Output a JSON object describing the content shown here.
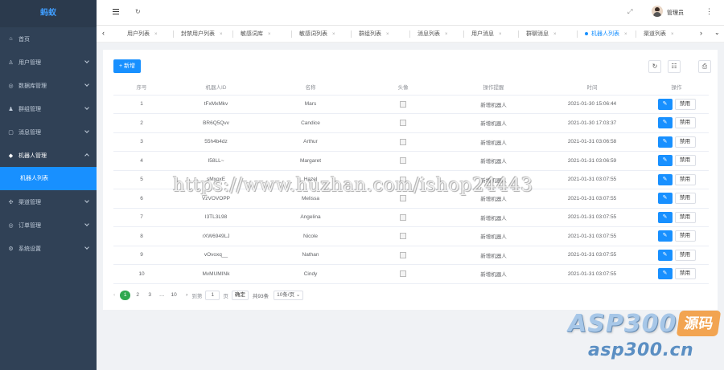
{
  "sidebar": {
    "logo": "蚂蚁",
    "items": [
      {
        "label": "首页",
        "icon": "home-icon",
        "glyph": "⌂"
      },
      {
        "label": "用户管理",
        "icon": "user-icon",
        "glyph": "♙"
      },
      {
        "label": "数据库管理",
        "icon": "database-icon",
        "glyph": "◎"
      },
      {
        "label": "群组管理",
        "icon": "group-icon",
        "glyph": "♟"
      },
      {
        "label": "消息管理",
        "icon": "message-icon",
        "glyph": "▢"
      },
      {
        "label": "机器人管理",
        "icon": "robot-icon",
        "glyph": "◆"
      },
      {
        "label": "渠道管理",
        "icon": "channel-icon",
        "glyph": "✣"
      },
      {
        "label": "订单管理",
        "icon": "order-icon",
        "glyph": "◎"
      },
      {
        "label": "系统设置",
        "icon": "settings-icon",
        "glyph": "⚙"
      }
    ],
    "submenu_selected": "机器人列表"
  },
  "header": {
    "username": "管理员",
    "hamburger_icon": "menu-toggle-icon",
    "refresh_glyph": "↻",
    "fullscreen_glyph": "⤢",
    "more_glyph": "⋮"
  },
  "tabs": {
    "items": [
      {
        "label": "用户列表"
      },
      {
        "label": "封禁用户列表"
      },
      {
        "label": "敏感词库"
      },
      {
        "label": "敏感词列表"
      },
      {
        "label": "群组列表"
      },
      {
        "label": "消息列表"
      },
      {
        "label": "用户消息"
      },
      {
        "label": "群聊消息"
      },
      {
        "label": "机器人列表",
        "active": true
      },
      {
        "label": "渠道列表"
      }
    ],
    "close_glyph": "×",
    "left_arrow": "‹",
    "right_arrow": "›",
    "dropdown_glyph": "⌄"
  },
  "toolbar": {
    "add_label": "+ 新增",
    "tools": [
      {
        "name": "refresh-icon",
        "glyph": "↻"
      },
      {
        "name": "columns-icon",
        "glyph": "☷"
      },
      {
        "name": "print-icon",
        "glyph": "⎙"
      }
    ]
  },
  "table": {
    "columns": [
      "序号",
      "机器人ID",
      "名称",
      "头像",
      "操作提醒",
      "时间",
      "操作"
    ],
    "rows": [
      {
        "index": "1",
        "id": "tFxMxMkv",
        "name": "Mars",
        "remark": "新增机器人",
        "time": "2021-01-30 15:06:44"
      },
      {
        "index": "2",
        "id": "BR6Q5Qvv",
        "name": "Candice",
        "remark": "新增机器人",
        "time": "2021-01-30 17:03:37"
      },
      {
        "index": "3",
        "id": "55h4b4dz",
        "name": "Arthur",
        "remark": "新增机器人",
        "time": "2021-01-31 03:06:58"
      },
      {
        "index": "4",
        "id": "I58LL~",
        "name": "Margaret",
        "remark": "新增机器人",
        "time": "2021-01-31 03:06:59"
      },
      {
        "index": "5",
        "id": "sMxoxE",
        "name": "Hazel",
        "remark": "新增机器人",
        "time": "2021-01-31 03:07:55"
      },
      {
        "index": "6",
        "id": "VzVOVOPP",
        "name": "Melissa",
        "remark": "新增机器人",
        "time": "2021-01-31 03:07:55"
      },
      {
        "index": "7",
        "id": "I3TL3L98",
        "name": "Angelina",
        "remark": "新增机器人",
        "time": "2021-01-31 03:07:55"
      },
      {
        "index": "8",
        "id": "rXW6949LJ",
        "name": "Nicole",
        "remark": "新增机器人",
        "time": "2021-01-31 03:07:55"
      },
      {
        "index": "9",
        "id": "vOvoxq__",
        "name": "Nathan",
        "remark": "新增机器人",
        "time": "2021-01-31 03:07:55"
      },
      {
        "index": "10",
        "id": "MvMUMINk",
        "name": "Cindy",
        "remark": "新增机器人",
        "time": "2021-01-31 03:07:55"
      }
    ],
    "edit_glyph": "✎",
    "disable_label": "禁用"
  },
  "pagination": {
    "prev": "‹",
    "pages": [
      "1",
      "2",
      "3",
      "…",
      "10"
    ],
    "current": "1",
    "next": "›",
    "goto_label": "到第",
    "goto_value": "1",
    "page_suffix": "页",
    "confirm_label": "确定",
    "total_label": "共93条",
    "page_size": "10条/页 ⌄"
  },
  "watermark": {
    "url": "https://www.huzhan.com/ishop24443",
    "brand": "ASP300",
    "brand_tag": "源码",
    "domain": "asp300.cn"
  }
}
